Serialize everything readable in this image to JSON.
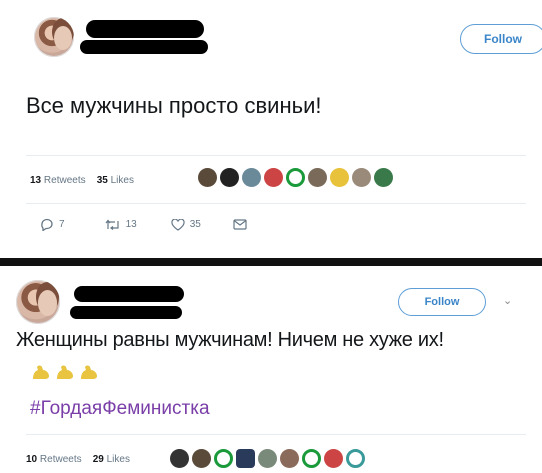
{
  "tweet1": {
    "follow_label": "Follow",
    "text": "Все мужчины просто свиньи!",
    "retweets_count": "13",
    "retweets_label": "Retweets",
    "likes_count": "35",
    "likes_label": "Likes",
    "reply_count": "7",
    "retweet_action_count": "13",
    "like_action_count": "35"
  },
  "tweet2": {
    "follow_label": "Follow",
    "text": "Женщины равны мужчинам! Ничем не хуже их!",
    "hashtag": "#ГордаяФеминистка",
    "retweets_count": "10",
    "retweets_label": "Retweets",
    "likes_count": "29",
    "likes_label": "Likes"
  },
  "colors": {
    "follow_blue": "#3a85c8",
    "hashtag_purple": "#7a3ea8",
    "separator": "#111111"
  },
  "icons": [
    "reply-icon",
    "retweet-icon",
    "heart-icon",
    "dm-icon",
    "chevron-down-icon",
    "flexed-biceps-icon"
  ]
}
